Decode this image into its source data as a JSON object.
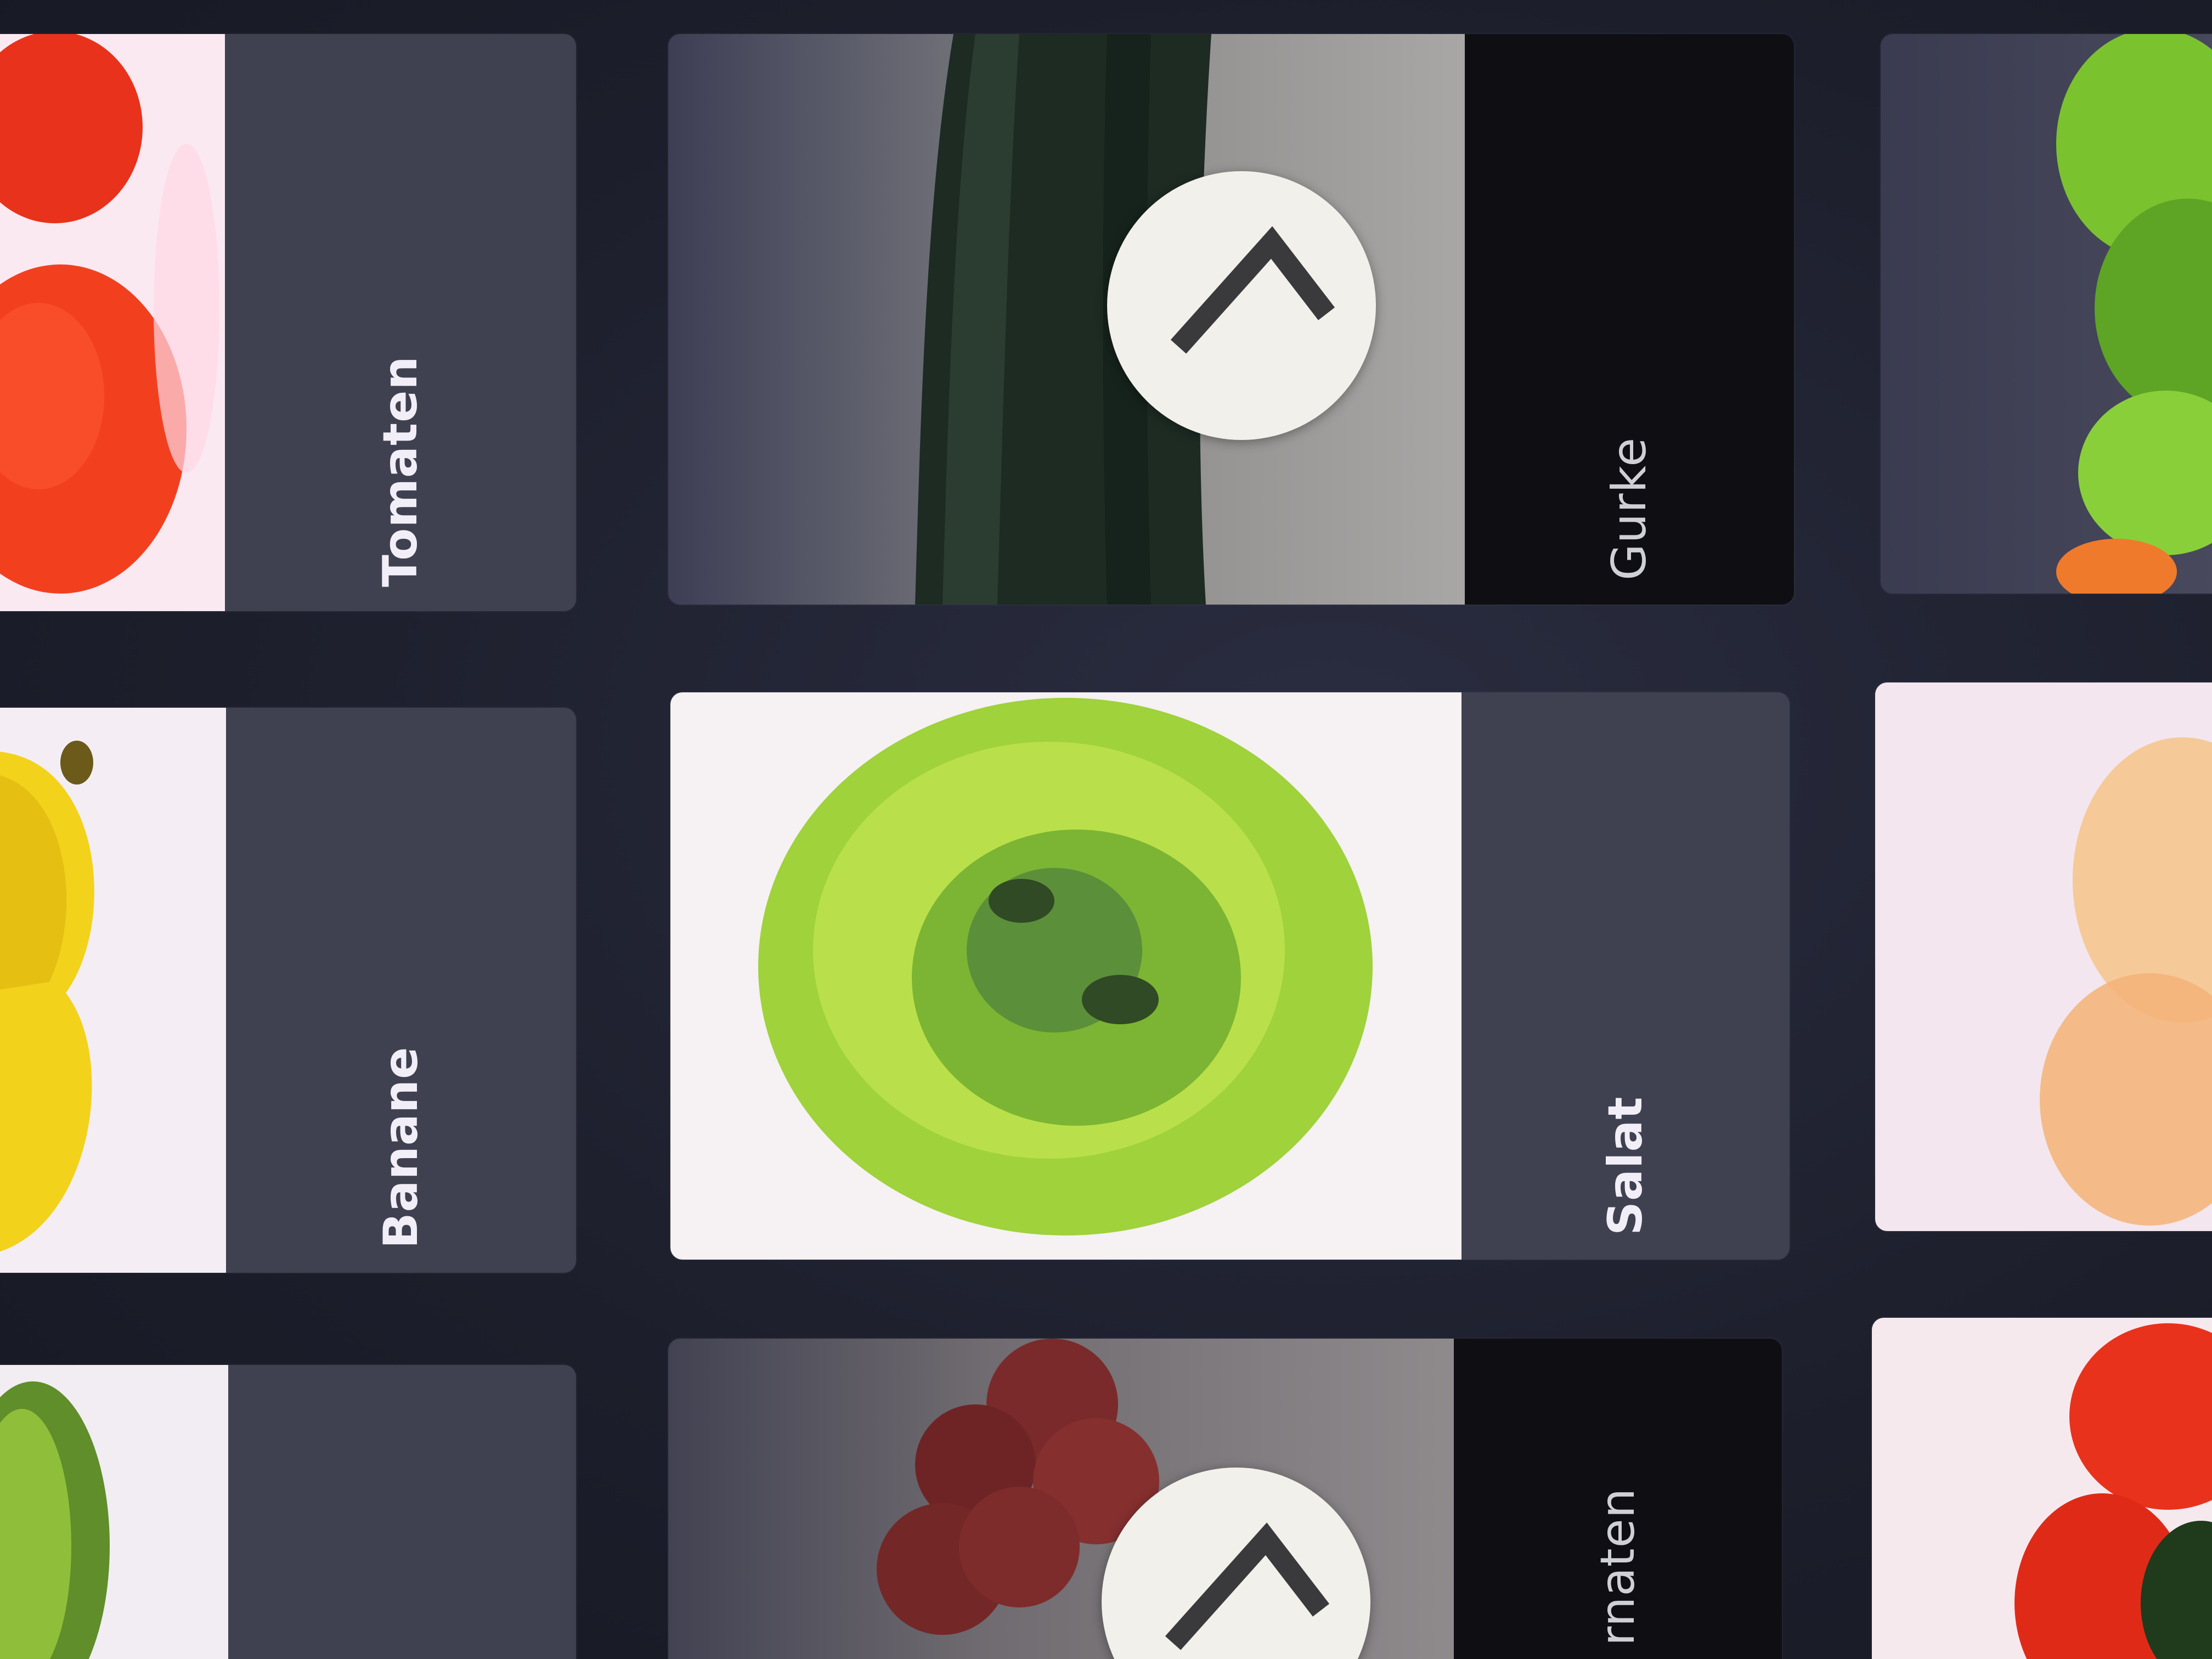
{
  "tiles": [
    {
      "label": "Tomaten",
      "photo": "tomato-photo"
    },
    {
      "label": "Gurke",
      "photo": "cucumber-photo",
      "has_arrow": true,
      "arrow_icon": "chevron-right-icon"
    },
    {
      "label": "",
      "photo": "herbs-photo"
    },
    {
      "label": "Banane",
      "photo": "banana-photo"
    },
    {
      "label": "Salat",
      "photo": "lettuce-photo"
    },
    {
      "label": "",
      "photo": "peach-photo"
    },
    {
      "label": "",
      "photo": "kiwi-photo"
    },
    {
      "label": "rnaten",
      "photo": "grapes-photo",
      "has_arrow": true,
      "arrow_icon": "chevron-right-icon"
    },
    {
      "label": "",
      "photo": "pepper-photo"
    }
  ],
  "colors": {
    "background": "#1f2230",
    "label_strip": "#3f4150",
    "label_strip_dark": "#0f0f13",
    "label_text": "#f2eef8",
    "arrow_button": "#f1f0ea",
    "arrow_stroke": "#3a3a3d"
  }
}
